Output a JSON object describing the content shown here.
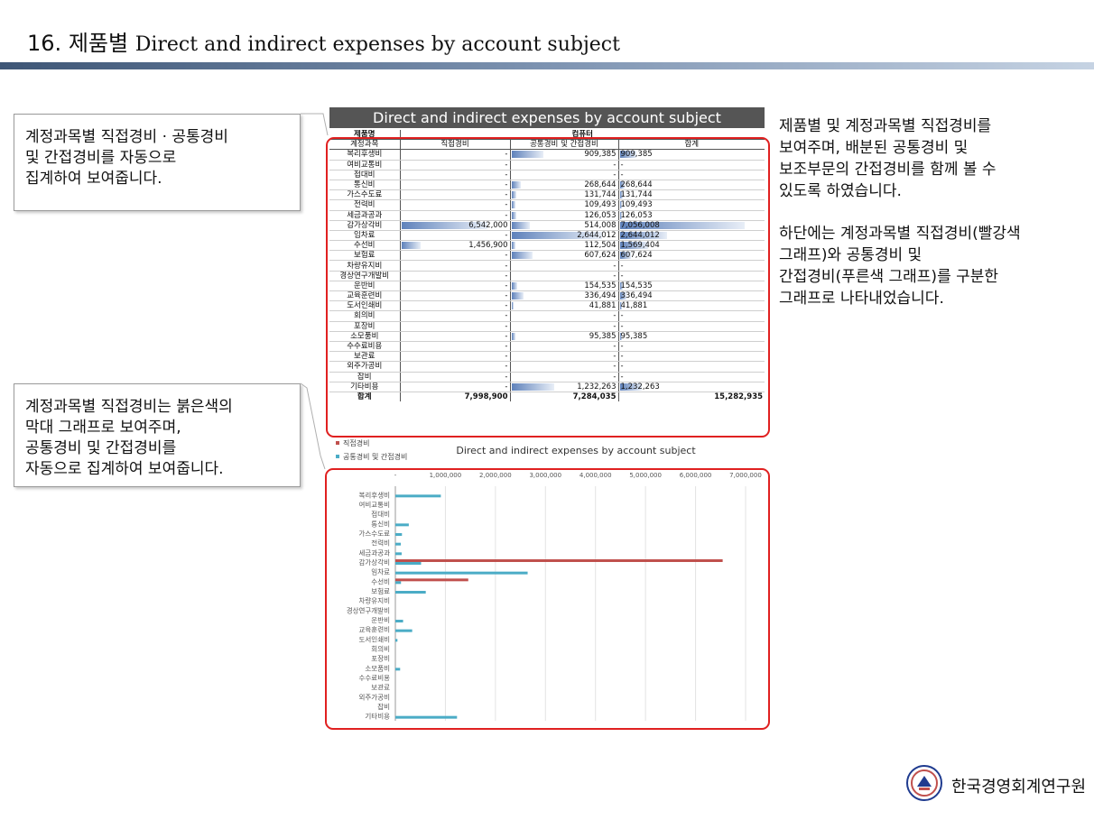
{
  "slide": {
    "number": "16.",
    "title_ko": "제품별",
    "title_en": "Direct and indirect expenses by account subject"
  },
  "callouts": [
    "계정과목별 직접경비 · 공통경비\n및 간접경비를 자동으로\n집계하여 보여줍니다.",
    "계정과목별 직접경비는 붉은색의\n막대 그래프로 보여주며,\n공통경비 및 간접경비를\n자동으로 집계하여 보여줍니다."
  ],
  "notes": [
    "제품별 및 계정과목별 직접경비를\n보여주며, 배분된 공통경비 및\n보조부문의 간접경비를 함께 볼 수\n있도록 하였습니다.",
    "하단에는 계정과목별 직접경비(빨강색\n그래프)와 공통경비 및\n간접경비(푸른색 그래프)를 구분한\n그래프로 나타내었습니다."
  ],
  "table": {
    "title": "Direct and indirect expenses by account subject",
    "product_label": "제품명",
    "product_name": "컴퓨터",
    "columns": [
      "계정과목",
      "직접경비",
      "공통경비 및 간접경비",
      "합계"
    ],
    "rows": [
      {
        "name": "복리후생비",
        "direct": "-",
        "indirect": "909,385",
        "total": "909,385"
      },
      {
        "name": "여비교통비",
        "direct": "-",
        "indirect": "-",
        "total": "-"
      },
      {
        "name": "접대비",
        "direct": "-",
        "indirect": "-",
        "total": "-"
      },
      {
        "name": "통신비",
        "direct": "-",
        "indirect": "268,644",
        "total": "268,644"
      },
      {
        "name": "가스수도료",
        "direct": "-",
        "indirect": "131,744",
        "total": "131,744"
      },
      {
        "name": "전력비",
        "direct": "-",
        "indirect": "109,493",
        "total": "109,493"
      },
      {
        "name": "세금과공과",
        "direct": "-",
        "indirect": "126,053",
        "total": "126,053"
      },
      {
        "name": "감가상각비",
        "direct": "6,542,000",
        "indirect": "514,008",
        "total": "7,056,008"
      },
      {
        "name": "임차료",
        "direct": "-",
        "indirect": "2,644,012",
        "total": "2,644,012"
      },
      {
        "name": "수선비",
        "direct": "1,456,900",
        "indirect": "112,504",
        "total": "1,569,404"
      },
      {
        "name": "보험료",
        "direct": "-",
        "indirect": "607,624",
        "total": "607,624"
      },
      {
        "name": "차량유지비",
        "direct": "-",
        "indirect": "-",
        "total": "-"
      },
      {
        "name": "경상연구개발비",
        "direct": "-",
        "indirect": "-",
        "total": "-"
      },
      {
        "name": "운반비",
        "direct": "-",
        "indirect": "154,535",
        "total": "154,535"
      },
      {
        "name": "교육훈련비",
        "direct": "-",
        "indirect": "336,494",
        "total": "336,494"
      },
      {
        "name": "도서인쇄비",
        "direct": "-",
        "indirect": "41,881",
        "total": "41,881"
      },
      {
        "name": "회의비",
        "direct": "-",
        "indirect": "-",
        "total": "-"
      },
      {
        "name": "포장비",
        "direct": "-",
        "indirect": "-",
        "total": "-"
      },
      {
        "name": "소모품비",
        "direct": "-",
        "indirect": "95,385",
        "total": "95,385"
      },
      {
        "name": "수수료비용",
        "direct": "-",
        "indirect": "-",
        "total": "-"
      },
      {
        "name": "보관료",
        "direct": "-",
        "indirect": "-",
        "total": "-"
      },
      {
        "name": "외주가공비",
        "direct": "-",
        "indirect": "-",
        "total": "-"
      },
      {
        "name": "잡비",
        "direct": "-",
        "indirect": "-",
        "total": "-"
      },
      {
        "name": "기타비용",
        "direct": "-",
        "indirect": "1,232,263",
        "total": "1,232,263"
      }
    ],
    "total": {
      "name": "합계",
      "direct": "7,998,900",
      "indirect": "7,284,035",
      "total": "15,282,935"
    }
  },
  "chart_data": {
    "type": "bar",
    "orientation": "horizontal",
    "title": "Direct and indirect expenses by account subject",
    "categories": [
      "복리후생비",
      "여비교통비",
      "접대비",
      "통신비",
      "가스수도료",
      "전력비",
      "세금과공과",
      "감가상각비",
      "임차료",
      "수선비",
      "보험료",
      "차량유지비",
      "경상연구개발비",
      "운반비",
      "교육훈련비",
      "도서인쇄비",
      "회의비",
      "포장비",
      "소모품비",
      "수수료비용",
      "보관료",
      "외주가공비",
      "잡비",
      "기타비용"
    ],
    "series": [
      {
        "name": "직접경비",
        "color": "#c0504d",
        "values": [
          0,
          0,
          0,
          0,
          0,
          0,
          0,
          6542000,
          0,
          1456900,
          0,
          0,
          0,
          0,
          0,
          0,
          0,
          0,
          0,
          0,
          0,
          0,
          0,
          0
        ]
      },
      {
        "name": "공통경비 및 간접경비",
        "color": "#4bacc6",
        "values": [
          909385,
          0,
          0,
          268644,
          131744,
          109493,
          126053,
          514008,
          2644012,
          112504,
          607624,
          0,
          0,
          154535,
          336494,
          41881,
          0,
          0,
          95385,
          0,
          0,
          0,
          0,
          1232263
        ]
      }
    ],
    "xlim": [
      0,
      7000000
    ],
    "x_ticks": [
      "-",
      "1,000,000",
      "2,000,000",
      "3,000,000",
      "4,000,000",
      "5,000,000",
      "6,000,000",
      "7,000,000"
    ],
    "legend": "top-left",
    "grid": true
  },
  "footer": {
    "org_name": "한국경영회계연구원"
  }
}
